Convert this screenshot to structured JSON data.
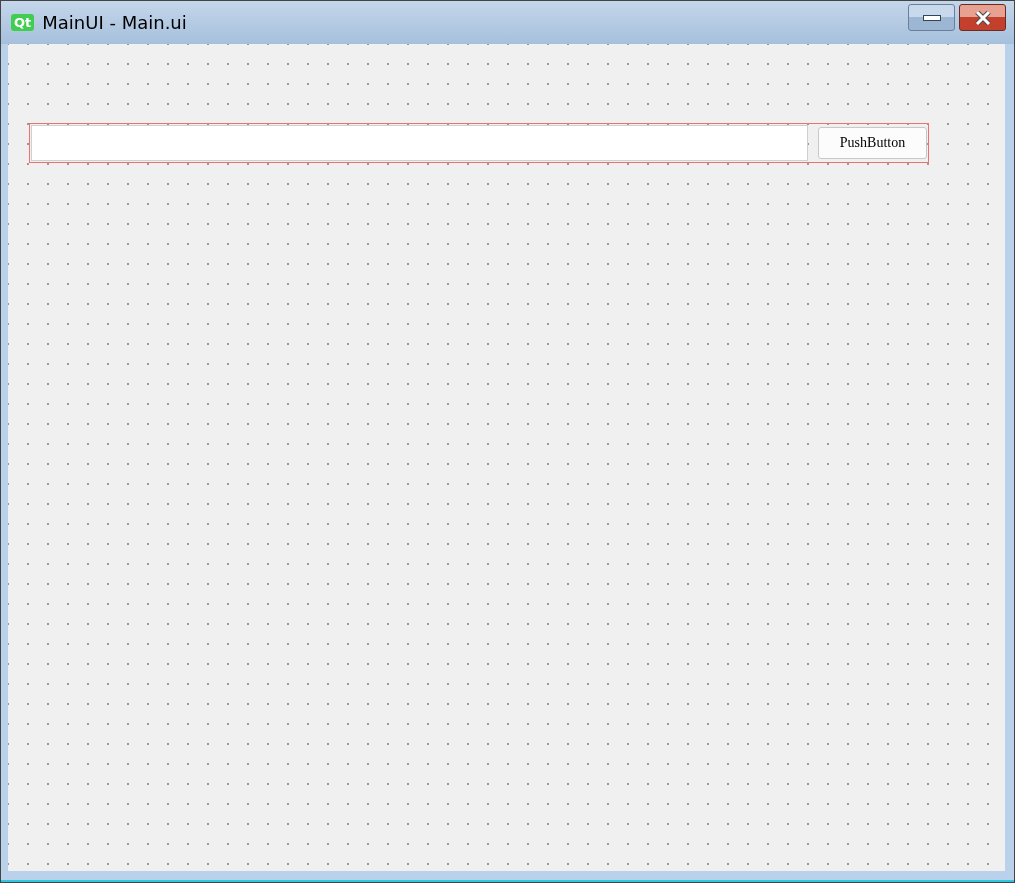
{
  "window": {
    "title": "MainUI - Main.ui",
    "app_badge": "Qt"
  },
  "form": {
    "button": {
      "label": "PushButton"
    }
  }
}
